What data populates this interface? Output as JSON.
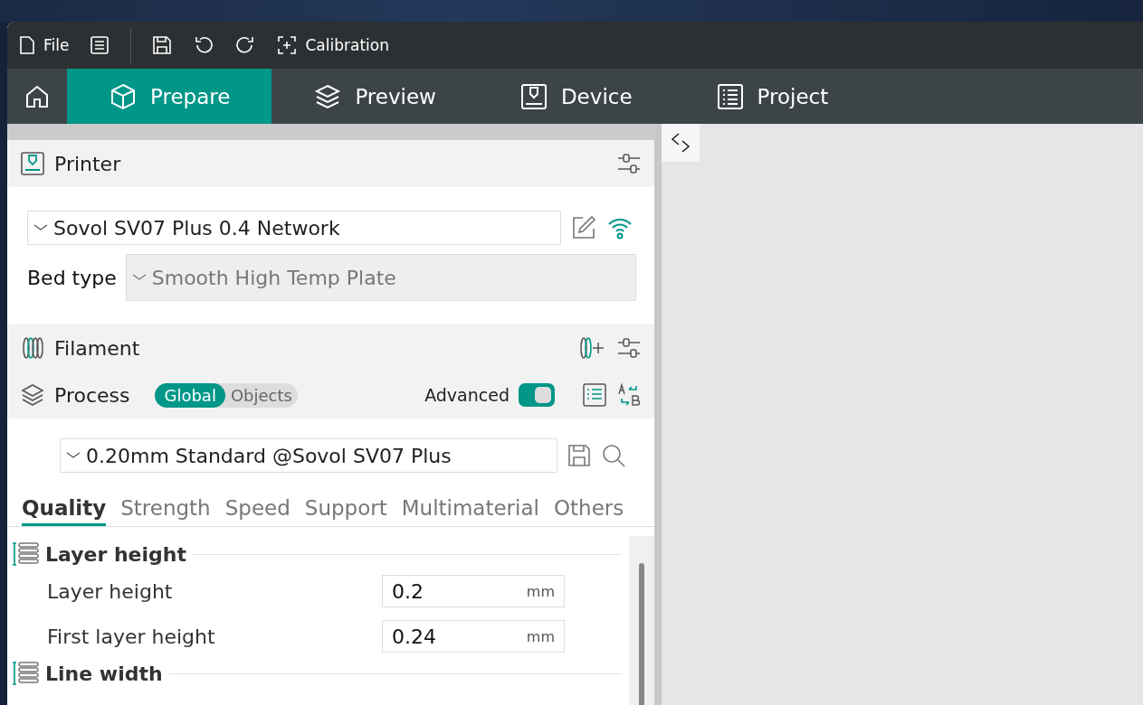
{
  "toolbar": {
    "file_label": "File",
    "calibration_label": "Calibration"
  },
  "nav_tabs": [
    {
      "kind": "home",
      "selected": false
    },
    {
      "kind": "prepare",
      "label": "Prepare",
      "selected": true
    },
    {
      "kind": "preview",
      "label": "Preview",
      "selected": false
    },
    {
      "kind": "device",
      "label": "Device",
      "selected": false
    },
    {
      "kind": "project",
      "label": "Project",
      "selected": false
    }
  ],
  "printer": {
    "title": "Printer",
    "preset": "Sovol SV07 Plus 0.4 Network",
    "bed_type_label": "Bed type",
    "bed_type": "Smooth High Temp Plate",
    "bed_type_disabled": true
  },
  "filament": {
    "title": "Filament"
  },
  "process": {
    "title": "Process",
    "scopes": [
      {
        "label": "Global",
        "selected": true
      },
      {
        "label": "Objects",
        "selected": false
      }
    ],
    "advanced_label": "Advanced",
    "advanced_on": true,
    "preset": "0.20mm Standard @Sovol SV07 Plus"
  },
  "setting_tabs": [
    {
      "label": "Quality",
      "selected": true
    },
    {
      "label": "Strength",
      "selected": false
    },
    {
      "label": "Speed",
      "selected": false
    },
    {
      "label": "Support",
      "selected": false
    },
    {
      "label": "Multimaterial",
      "selected": false
    },
    {
      "label": "Others",
      "selected": false
    }
  ],
  "sections": [
    {
      "title": "Layer height",
      "settings": [
        {
          "label": "Layer height",
          "value": "0.2",
          "unit": "mm"
        },
        {
          "label": "First layer height",
          "value": "0.24",
          "unit": "mm"
        }
      ]
    },
    {
      "title": "Line width"
    }
  ]
}
